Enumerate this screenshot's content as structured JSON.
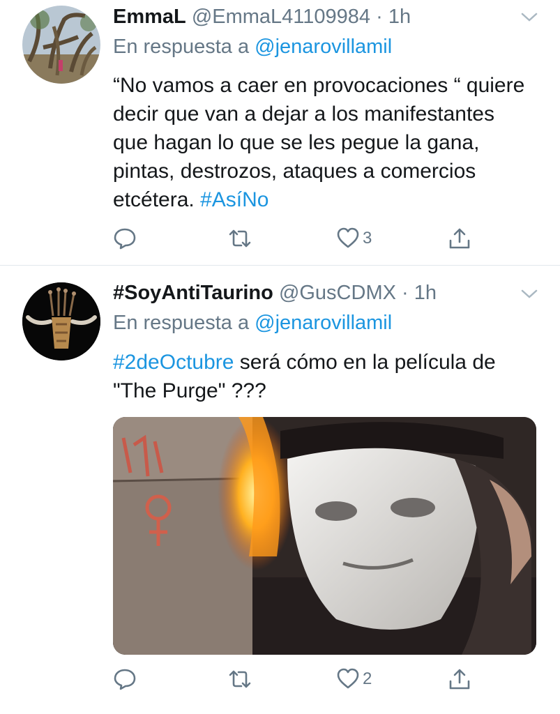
{
  "tweets": [
    {
      "display_name": "EmmaL",
      "handle": "@EmmaL41109984",
      "dot": "·",
      "time": "1h",
      "reply_prefix": "En respuesta a",
      "reply_to": "@jenarovillamil",
      "text_plain": "“No vamos a caer en provocaciones “ quiere decir que van a dejar a los manifestantes que hagan lo que se les pegue la gana, pintas, destrozos, ataques a comercios etcétera.",
      "hashtag": "#AsíNo",
      "counts": {
        "reply": "",
        "retweet": "",
        "like": "3"
      },
      "avatar_icon": "tree-avatar-icon"
    },
    {
      "display_name": "#SoyAntiTaurino",
      "handle": "@GusCDMX",
      "dot": "·",
      "time": "1h",
      "reply_prefix": "En respuesta a",
      "reply_to": "@jenarovillamil",
      "hashtag": "#2deOctubre",
      "text_plain": "será cómo en la película de \"The Purge\" ???",
      "counts": {
        "reply": "",
        "retweet": "",
        "like": "2"
      },
      "avatar_icon": "bull-skull-avatar-icon",
      "media": "masked-person-fire-photo"
    }
  ],
  "colors": {
    "link": "#1b95e0",
    "secondary": "#657786",
    "text": "#14171a",
    "divider": "#e1e8ed"
  },
  "icons": [
    "chevron-down-icon",
    "reply-icon",
    "retweet-icon",
    "like-icon",
    "share-icon"
  ]
}
